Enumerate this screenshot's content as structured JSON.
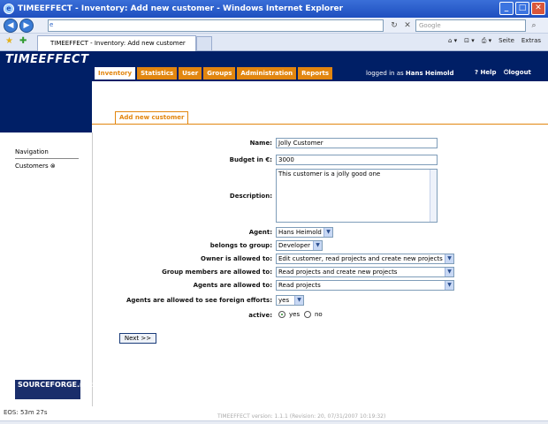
{
  "window": {
    "title": "TIMEEFFECT - Inventory: Add new customer - Windows Internet Explorer",
    "minimize": "_",
    "maximize": "□",
    "close": "✕"
  },
  "browser": {
    "back": "◀",
    "forward": "▶",
    "address": "",
    "search_placeholder": "Google",
    "tab_title": "TIMEEFFECT - Inventory: Add new customer",
    "page_menu": "Seite",
    "tools_menu": "Extras"
  },
  "app": {
    "logo": "TIMEEFFECT",
    "tabs": [
      "Inventory",
      "Statistics",
      "User",
      "Groups",
      "Administration",
      "Reports"
    ],
    "logged_in_prefix": "logged in as",
    "user": "Hans Heimold",
    "help": "? Help",
    "logout": "⏻logout",
    "section_tab": "Add new customer"
  },
  "sidebar": {
    "navigation": "Navigation",
    "customers": "Customers ⊗"
  },
  "form": {
    "name_label": "Name:",
    "name_value": "Jolly Customer",
    "budget_label": "Budget in €:",
    "budget_value": "3000",
    "description_label": "Description:",
    "description_value": "This customer is a jolly good one",
    "agent_label": "Agent:",
    "agent_value": "Hans Heimold",
    "group_label": "belongs to group:",
    "group_value": "Developer",
    "owner_label": "Owner is allowed to:",
    "owner_value": "Edit customer, read projects and create new projects",
    "groupmembers_label": "Group members are allowed to:",
    "groupmembers_value": "Read projects and create new projects",
    "agents_label": "Agents are allowed to:",
    "agents_value": "Read projects",
    "foreign_label": "Agents are allowed to see foreign efforts:",
    "foreign_value": "yes",
    "active_label": "active:",
    "active_yes": "yes",
    "active_no": "no",
    "next_button": "Next >>"
  },
  "footer": {
    "eos": "EOS: 53m 27s",
    "version": "TIMEEFFECT version: 1.1.1 (Revision: 20, 07/31/2007 10:19:32)",
    "sourceforge": "SOURCEFORGE.net"
  }
}
